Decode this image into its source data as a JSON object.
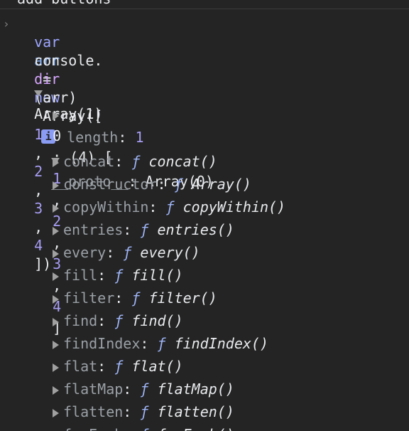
{
  "console": {
    "cropped_text": "add buttons",
    "input_lines": {
      "line1": {
        "kw1": "var",
        "id": "arr",
        "eq": " = ",
        "kw2": "new",
        "ctor": " Array([",
        "n1": "1",
        "n2": "2",
        "n3": "3",
        "n4": "4",
        "close": "])"
      },
      "line2": {
        "obj": "console.",
        "method": "dir",
        "args": "(arr)"
      }
    },
    "tree": {
      "root_label": "Array(1)",
      "info_icon": "i",
      "item0": {
        "key": "0",
        "summary_prefix": ": (4) [",
        "values": [
          "1",
          "2",
          "3",
          "4"
        ],
        "summary_suffix": "]"
      },
      "length": {
        "key": "length",
        "value": "1"
      },
      "proto": {
        "key": "__proto__",
        "value": ": Array(0)"
      },
      "methods": [
        {
          "name": "concat",
          "sig": "concat()"
        },
        {
          "name": "constructor",
          "sig": "Array()"
        },
        {
          "name": "copyWithin",
          "sig": "copyWithin()"
        },
        {
          "name": "entries",
          "sig": "entries()"
        },
        {
          "name": "every",
          "sig": "every()"
        },
        {
          "name": "fill",
          "sig": "fill()"
        },
        {
          "name": "filter",
          "sig": "filter()"
        },
        {
          "name": "find",
          "sig": "find()"
        },
        {
          "name": "findIndex",
          "sig": "findIndex()"
        },
        {
          "name": "flat",
          "sig": "flat()"
        },
        {
          "name": "flatMap",
          "sig": "flatMap()"
        },
        {
          "name": "flatten",
          "sig": "flatten()"
        },
        {
          "name": "forEach",
          "sig": "forEach()"
        }
      ],
      "f_symbol": "ƒ"
    }
  }
}
